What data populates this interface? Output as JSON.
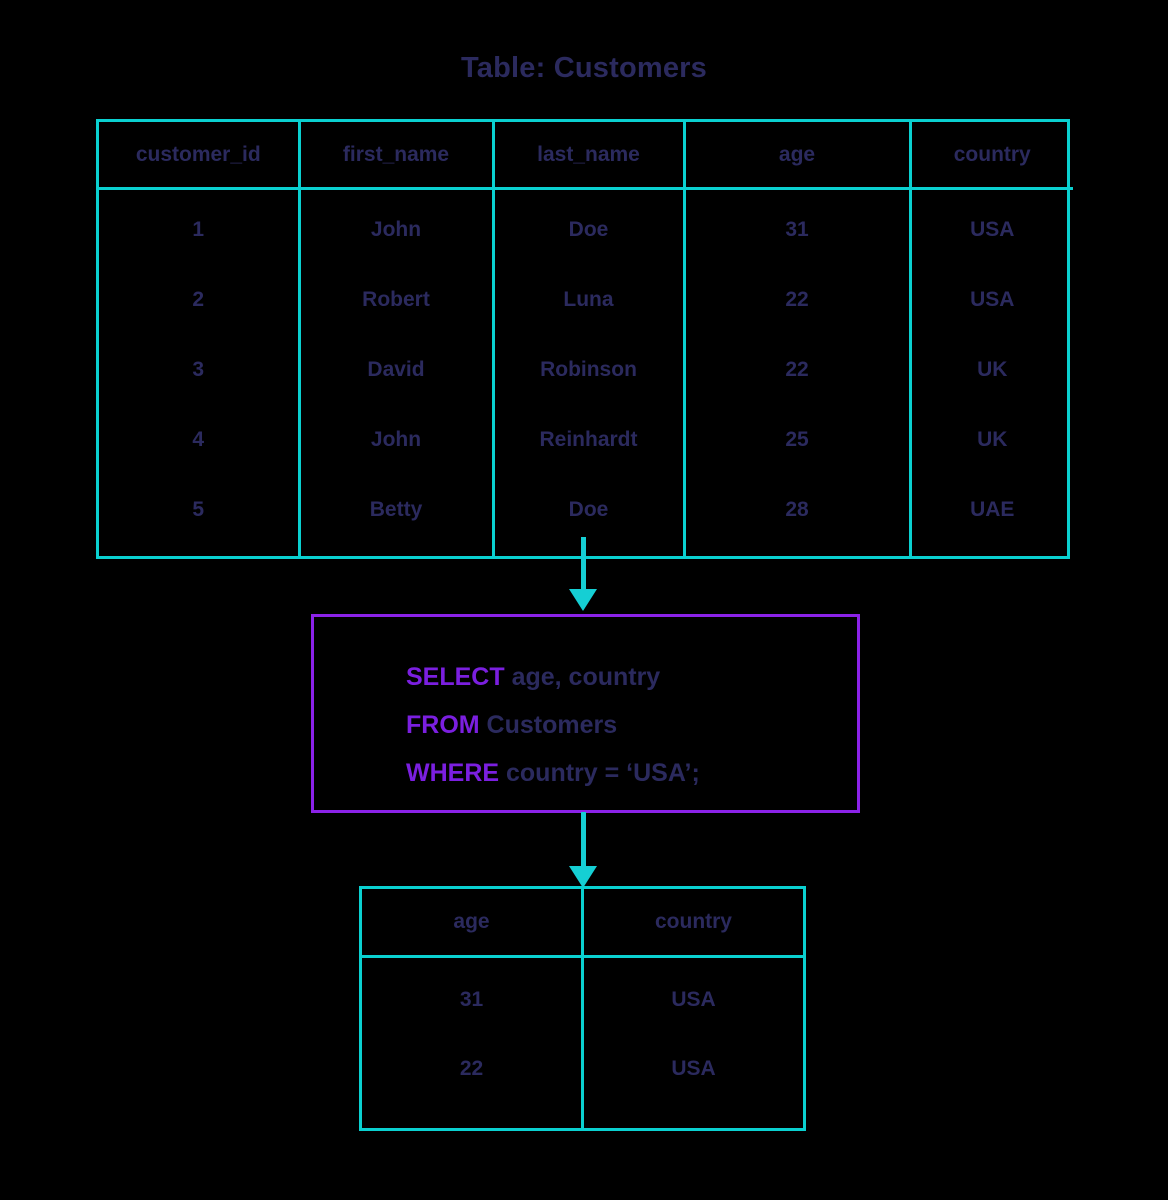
{
  "title": "Table: Customers",
  "colors": {
    "background": "#000000",
    "table_border": "#0ad0d0",
    "arrow": "#15cfd4",
    "query_border": "#8b22e8",
    "keyword": "#7b1fe0",
    "text": "#2b2a5e"
  },
  "source_table": {
    "name": "Customers",
    "columns": [
      "customer_id",
      "first_name",
      "last_name",
      "age",
      "country"
    ],
    "rows": [
      [
        "1",
        "John",
        "Doe",
        "31",
        "USA"
      ],
      [
        "2",
        "Robert",
        "Luna",
        "22",
        "USA"
      ],
      [
        "3",
        "David",
        "Robinson",
        "22",
        "UK"
      ],
      [
        "4",
        "John",
        "Reinhardt",
        "25",
        "UK"
      ],
      [
        "5",
        "Betty",
        "Doe",
        "28",
        "UAE"
      ]
    ]
  },
  "query": {
    "lines": [
      {
        "keyword": "SELECT",
        "rest": " age, country"
      },
      {
        "keyword": "FROM",
        "rest": " Customers"
      },
      {
        "keyword": "WHERE",
        "rest": " country = ‘USA’;"
      }
    ],
    "full_text": "SELECT age, country FROM Customers WHERE country = ‘USA’;"
  },
  "result_table": {
    "columns": [
      "age",
      "country"
    ],
    "rows": [
      [
        "31",
        "USA"
      ],
      [
        "22",
        "USA"
      ]
    ]
  },
  "arrows": [
    {
      "name": "table-to-query",
      "direction": "down"
    },
    {
      "name": "query-to-result",
      "direction": "down"
    }
  ]
}
